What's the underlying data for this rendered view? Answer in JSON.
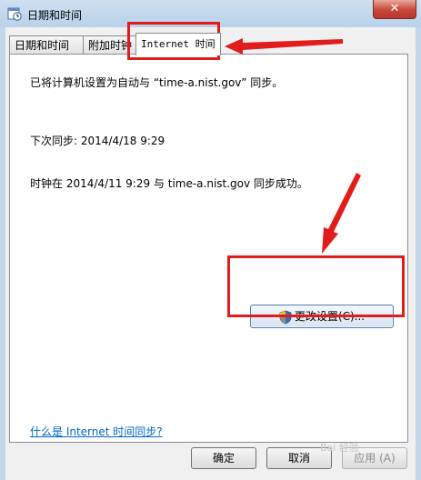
{
  "window": {
    "title": "日期和时间",
    "close_label": "✕"
  },
  "tabs": [
    {
      "label": "日期和时间"
    },
    {
      "label": "附加时钟"
    },
    {
      "label": "Internet 时间"
    }
  ],
  "panel": {
    "sync_config": "已将计算机设置为自动与 “time-a.nist.gov” 同步。",
    "next_sync": "下次同步: 2014/4/18 9:29",
    "last_sync": "时钟在 2014/4/11 9:29 与 time-a.nist.gov 同步成功。",
    "change_settings_label": "更改设置(C)...",
    "help_link": "什么是 Internet 时间同步?"
  },
  "buttons": {
    "ok": "确定",
    "cancel": "取消",
    "apply": "应用 (A)"
  },
  "watermark": "Bai 经验",
  "colors": {
    "annotation": "#e21b1b",
    "link": "#0066cc"
  },
  "icons": [
    "clock-calendar-icon",
    "close-icon",
    "uac-shield-icon"
  ]
}
